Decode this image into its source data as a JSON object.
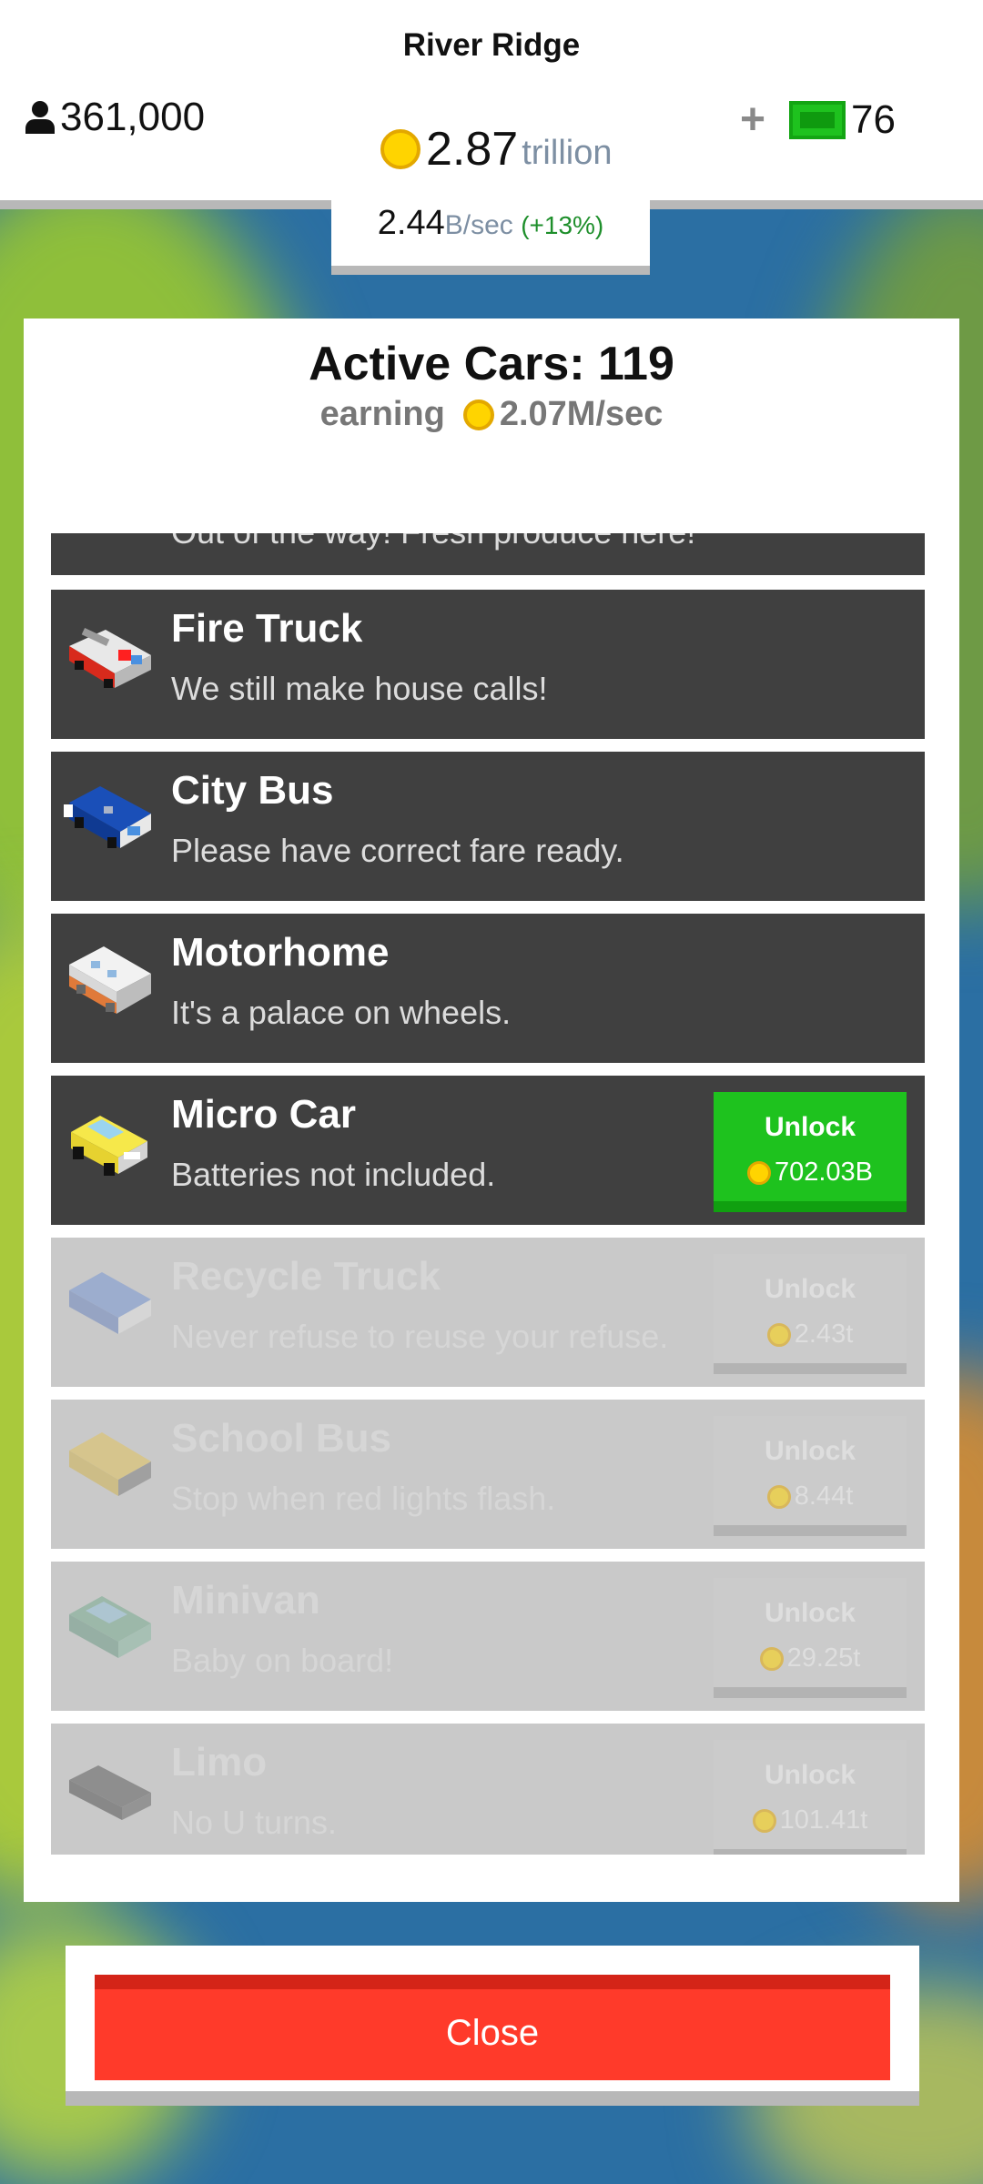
{
  "header": {
    "city_name": "River Ridge",
    "population": "361,000",
    "money_value": "2.87",
    "money_unit": "trillion",
    "gem_count": "76",
    "plus_label": "+"
  },
  "rate": {
    "value": "2.44",
    "unit": "B/sec",
    "change": "(+13%)"
  },
  "panel": {
    "title": "Active Cars: 119",
    "earning_label": "earning",
    "earning_value": "2.07M/sec"
  },
  "cars": [
    {
      "name": "",
      "desc": "Out of the way! Fresh produce here!",
      "locked": false
    },
    {
      "name": "Fire Truck",
      "desc": "We still make house calls!",
      "locked": false,
      "icon": "fire-truck-icon"
    },
    {
      "name": "City Bus",
      "desc": "Please have correct fare ready.",
      "locked": false,
      "icon": "city-bus-icon"
    },
    {
      "name": "Motorhome",
      "desc": "It's a palace on wheels.",
      "locked": false,
      "icon": "motorhome-icon"
    },
    {
      "name": "Micro Car",
      "desc": "Batteries not included.",
      "locked": false,
      "icon": "micro-car-icon",
      "unlock_label": "Unlock",
      "price": "702.03B"
    },
    {
      "name": "Recycle Truck",
      "desc": "Never refuse to reuse your refuse.",
      "locked": true,
      "icon": "recycle-truck-icon",
      "unlock_label": "Unlock",
      "price": "2.43t"
    },
    {
      "name": "School Bus",
      "desc": "Stop when red lights flash.",
      "locked": true,
      "icon": "school-bus-icon",
      "unlock_label": "Unlock",
      "price": "8.44t"
    },
    {
      "name": "Minivan",
      "desc": "Baby on board!",
      "locked": true,
      "icon": "minivan-icon",
      "unlock_label": "Unlock",
      "price": "29.25t"
    },
    {
      "name": "Limo",
      "desc": "No U turns.",
      "locked": true,
      "icon": "limo-icon",
      "unlock_label": "Unlock",
      "price": "101.41t"
    }
  ],
  "close_label": "Close",
  "colors": {
    "unlock_green": "#1ec21e",
    "close_red": "#ff3a2a",
    "card_dark": "#404040"
  }
}
